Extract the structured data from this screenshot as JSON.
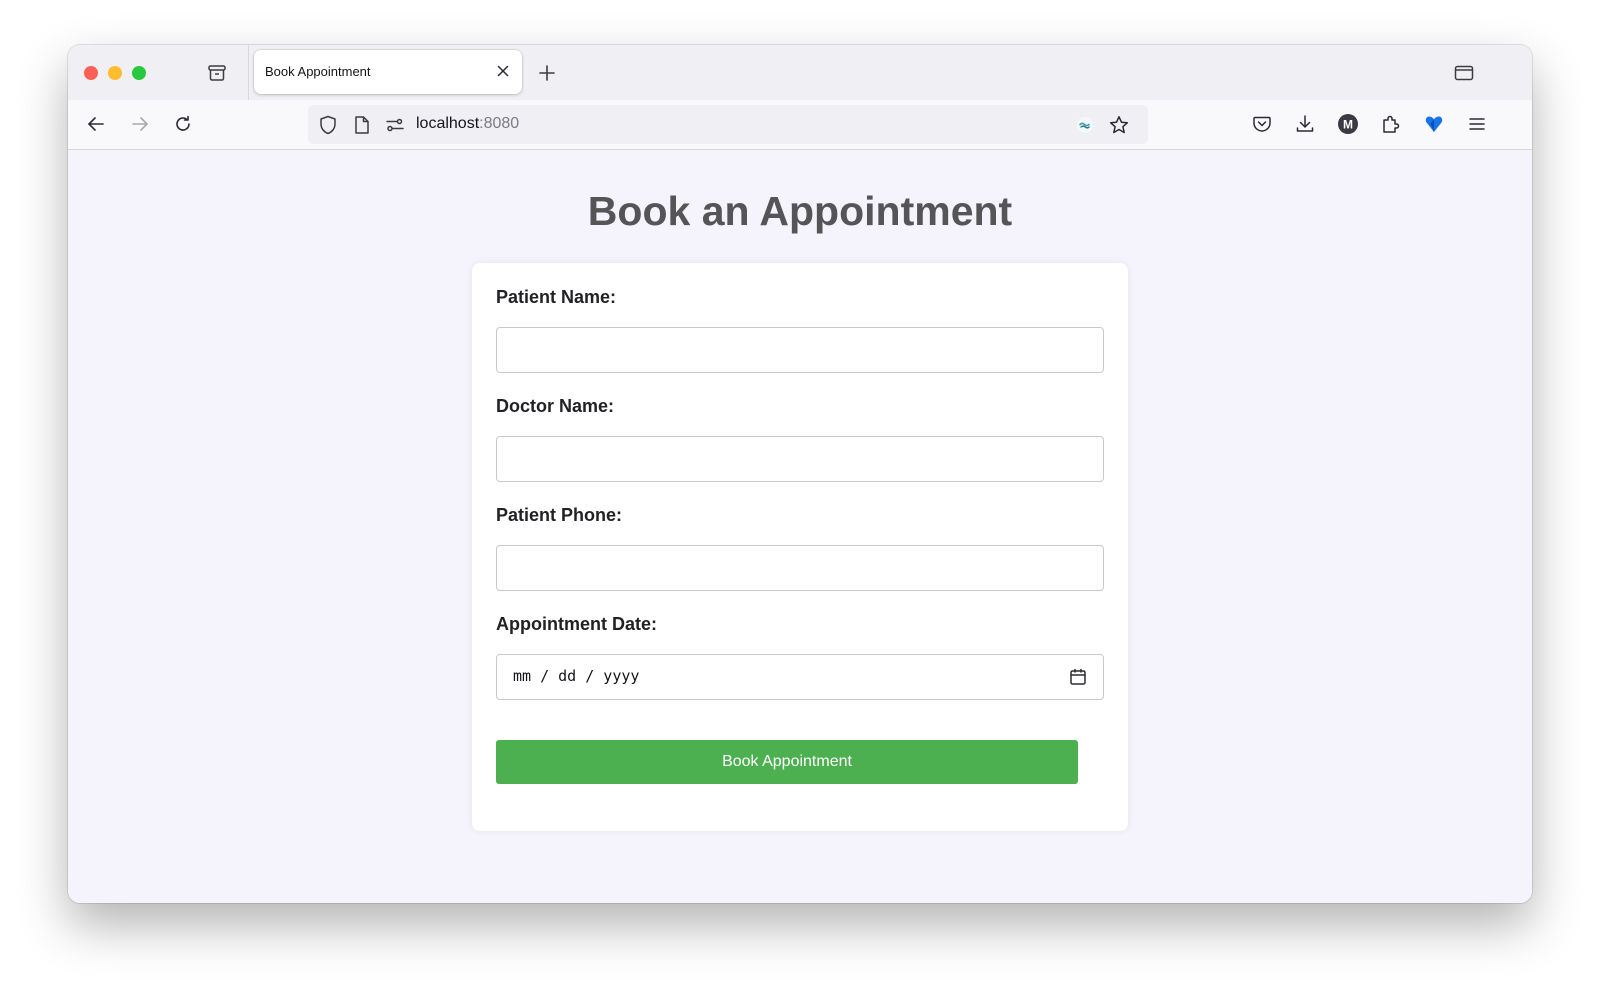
{
  "browser": {
    "tab_title": "Book Appointment",
    "url_host": "localhost",
    "url_port": ":8080"
  },
  "page": {
    "title": "Book an Appointment"
  },
  "form": {
    "patient_name_label": "Patient Name:",
    "patient_name_value": "",
    "doctor_name_label": "Doctor Name:",
    "doctor_name_value": "",
    "patient_phone_label": "Patient Phone:",
    "patient_phone_value": "",
    "date_label": "Appointment Date:",
    "date_placeholder": "mm / dd / yyyy",
    "submit_label": "Book Appointment"
  },
  "colors": {
    "submit_bg": "#4caf50",
    "page_bg": "#f5f4fc",
    "title_color": "#555558"
  },
  "icons": {
    "tab_strip": [
      "firefox-view-icon",
      "close-icon",
      "new-tab-plus-icon",
      "tab-overview-icon"
    ],
    "nav": [
      "back-arrow-icon",
      "forward-arrow-icon",
      "reload-icon",
      "shield-icon",
      "page-icon",
      "site-permissions-icon",
      "extension-wave-icon",
      "bookmark-star-icon",
      "pocket-icon",
      "download-icon",
      "account-m-icon",
      "extensions-puzzle-icon",
      "extension-heart-icon",
      "hamburger-menu-icon"
    ],
    "form": [
      "calendar-icon"
    ]
  }
}
